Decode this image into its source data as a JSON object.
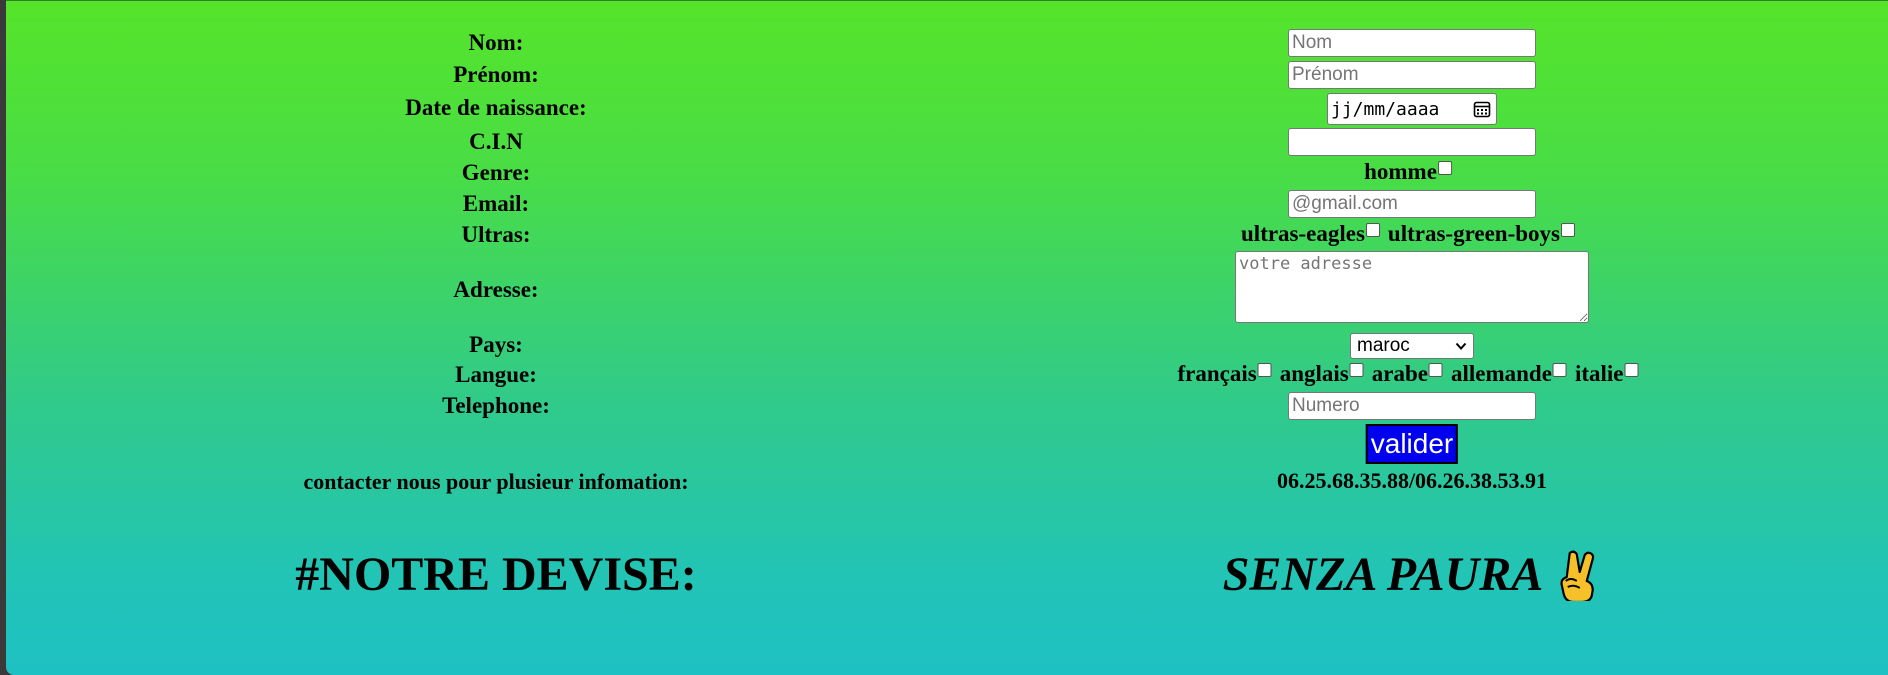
{
  "form": {
    "nom": {
      "label": "Nom:",
      "placeholder": "Nom",
      "value": ""
    },
    "prenom": {
      "label": "Prénom:",
      "placeholder": "Prénom",
      "value": ""
    },
    "naissance": {
      "label": "Date de naissance:",
      "display": "jj/mm/aaaa",
      "icon": "calendar-icon"
    },
    "cin": {
      "label": "C.I.N",
      "placeholder": "",
      "value": ""
    },
    "genre": {
      "label": "Genre:",
      "options": [
        {
          "label": "homme",
          "checked": false
        }
      ]
    },
    "email": {
      "label": "Email:",
      "placeholder": "@gmail.com",
      "value": ""
    },
    "ultras": {
      "label": "Ultras:",
      "options": [
        {
          "label": "ultras-eagles",
          "checked": false
        },
        {
          "label": "ultras-green-boys",
          "checked": false
        }
      ]
    },
    "adresse": {
      "label": "Adresse:",
      "placeholder": "votre adresse",
      "value": ""
    },
    "pays": {
      "label": "Pays:",
      "selected": "maroc"
    },
    "langue": {
      "label": "Langue:",
      "options": [
        {
          "label": "français",
          "checked": false
        },
        {
          "label": "anglais",
          "checked": false
        },
        {
          "label": "arabe",
          "checked": false
        },
        {
          "label": "allemande",
          "checked": false
        },
        {
          "label": "italie",
          "checked": false
        }
      ]
    },
    "telephone": {
      "label": "Telephone:",
      "placeholder": "Numero",
      "value": ""
    },
    "submit_label": "valider"
  },
  "contact": {
    "label": "contacter nous pour plusieur infomation:",
    "phones": "06.25.68.35.88/06.26.38.53.91"
  },
  "devise": {
    "label": "#NOTRE DEVISE:",
    "motto": "SENZA PAURA",
    "icon": "victory-hand-icon"
  },
  "colors": {
    "gradient_top": "#56e42a",
    "gradient_bottom": "#1ec1c3",
    "button_bg": "#0000ee"
  }
}
